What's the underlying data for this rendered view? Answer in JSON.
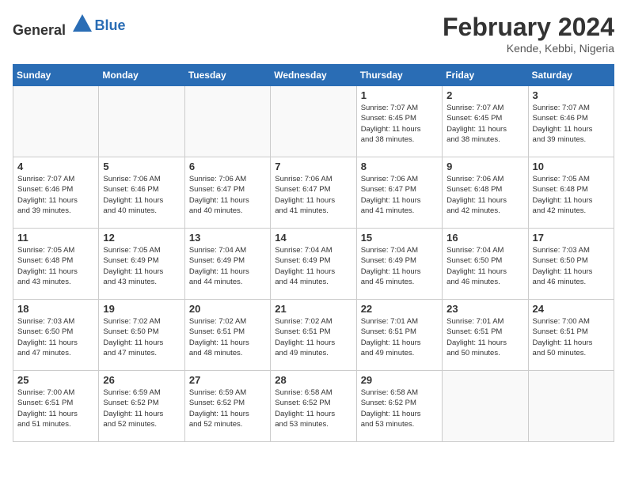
{
  "header": {
    "logo_general": "General",
    "logo_blue": "Blue",
    "month_year": "February 2024",
    "location": "Kende, Kebbi, Nigeria"
  },
  "weekdays": [
    "Sunday",
    "Monday",
    "Tuesday",
    "Wednesday",
    "Thursday",
    "Friday",
    "Saturday"
  ],
  "weeks": [
    [
      {
        "day": "",
        "info": ""
      },
      {
        "day": "",
        "info": ""
      },
      {
        "day": "",
        "info": ""
      },
      {
        "day": "",
        "info": ""
      },
      {
        "day": "1",
        "info": "Sunrise: 7:07 AM\nSunset: 6:45 PM\nDaylight: 11 hours\nand 38 minutes."
      },
      {
        "day": "2",
        "info": "Sunrise: 7:07 AM\nSunset: 6:45 PM\nDaylight: 11 hours\nand 38 minutes."
      },
      {
        "day": "3",
        "info": "Sunrise: 7:07 AM\nSunset: 6:46 PM\nDaylight: 11 hours\nand 39 minutes."
      }
    ],
    [
      {
        "day": "4",
        "info": "Sunrise: 7:07 AM\nSunset: 6:46 PM\nDaylight: 11 hours\nand 39 minutes."
      },
      {
        "day": "5",
        "info": "Sunrise: 7:06 AM\nSunset: 6:46 PM\nDaylight: 11 hours\nand 40 minutes."
      },
      {
        "day": "6",
        "info": "Sunrise: 7:06 AM\nSunset: 6:47 PM\nDaylight: 11 hours\nand 40 minutes."
      },
      {
        "day": "7",
        "info": "Sunrise: 7:06 AM\nSunset: 6:47 PM\nDaylight: 11 hours\nand 41 minutes."
      },
      {
        "day": "8",
        "info": "Sunrise: 7:06 AM\nSunset: 6:47 PM\nDaylight: 11 hours\nand 41 minutes."
      },
      {
        "day": "9",
        "info": "Sunrise: 7:06 AM\nSunset: 6:48 PM\nDaylight: 11 hours\nand 42 minutes."
      },
      {
        "day": "10",
        "info": "Sunrise: 7:05 AM\nSunset: 6:48 PM\nDaylight: 11 hours\nand 42 minutes."
      }
    ],
    [
      {
        "day": "11",
        "info": "Sunrise: 7:05 AM\nSunset: 6:48 PM\nDaylight: 11 hours\nand 43 minutes."
      },
      {
        "day": "12",
        "info": "Sunrise: 7:05 AM\nSunset: 6:49 PM\nDaylight: 11 hours\nand 43 minutes."
      },
      {
        "day": "13",
        "info": "Sunrise: 7:04 AM\nSunset: 6:49 PM\nDaylight: 11 hours\nand 44 minutes."
      },
      {
        "day": "14",
        "info": "Sunrise: 7:04 AM\nSunset: 6:49 PM\nDaylight: 11 hours\nand 44 minutes."
      },
      {
        "day": "15",
        "info": "Sunrise: 7:04 AM\nSunset: 6:49 PM\nDaylight: 11 hours\nand 45 minutes."
      },
      {
        "day": "16",
        "info": "Sunrise: 7:04 AM\nSunset: 6:50 PM\nDaylight: 11 hours\nand 46 minutes."
      },
      {
        "day": "17",
        "info": "Sunrise: 7:03 AM\nSunset: 6:50 PM\nDaylight: 11 hours\nand 46 minutes."
      }
    ],
    [
      {
        "day": "18",
        "info": "Sunrise: 7:03 AM\nSunset: 6:50 PM\nDaylight: 11 hours\nand 47 minutes."
      },
      {
        "day": "19",
        "info": "Sunrise: 7:02 AM\nSunset: 6:50 PM\nDaylight: 11 hours\nand 47 minutes."
      },
      {
        "day": "20",
        "info": "Sunrise: 7:02 AM\nSunset: 6:51 PM\nDaylight: 11 hours\nand 48 minutes."
      },
      {
        "day": "21",
        "info": "Sunrise: 7:02 AM\nSunset: 6:51 PM\nDaylight: 11 hours\nand 49 minutes."
      },
      {
        "day": "22",
        "info": "Sunrise: 7:01 AM\nSunset: 6:51 PM\nDaylight: 11 hours\nand 49 minutes."
      },
      {
        "day": "23",
        "info": "Sunrise: 7:01 AM\nSunset: 6:51 PM\nDaylight: 11 hours\nand 50 minutes."
      },
      {
        "day": "24",
        "info": "Sunrise: 7:00 AM\nSunset: 6:51 PM\nDaylight: 11 hours\nand 50 minutes."
      }
    ],
    [
      {
        "day": "25",
        "info": "Sunrise: 7:00 AM\nSunset: 6:51 PM\nDaylight: 11 hours\nand 51 minutes."
      },
      {
        "day": "26",
        "info": "Sunrise: 6:59 AM\nSunset: 6:52 PM\nDaylight: 11 hours\nand 52 minutes."
      },
      {
        "day": "27",
        "info": "Sunrise: 6:59 AM\nSunset: 6:52 PM\nDaylight: 11 hours\nand 52 minutes."
      },
      {
        "day": "28",
        "info": "Sunrise: 6:58 AM\nSunset: 6:52 PM\nDaylight: 11 hours\nand 53 minutes."
      },
      {
        "day": "29",
        "info": "Sunrise: 6:58 AM\nSunset: 6:52 PM\nDaylight: 11 hours\nand 53 minutes."
      },
      {
        "day": "",
        "info": ""
      },
      {
        "day": "",
        "info": ""
      }
    ]
  ]
}
